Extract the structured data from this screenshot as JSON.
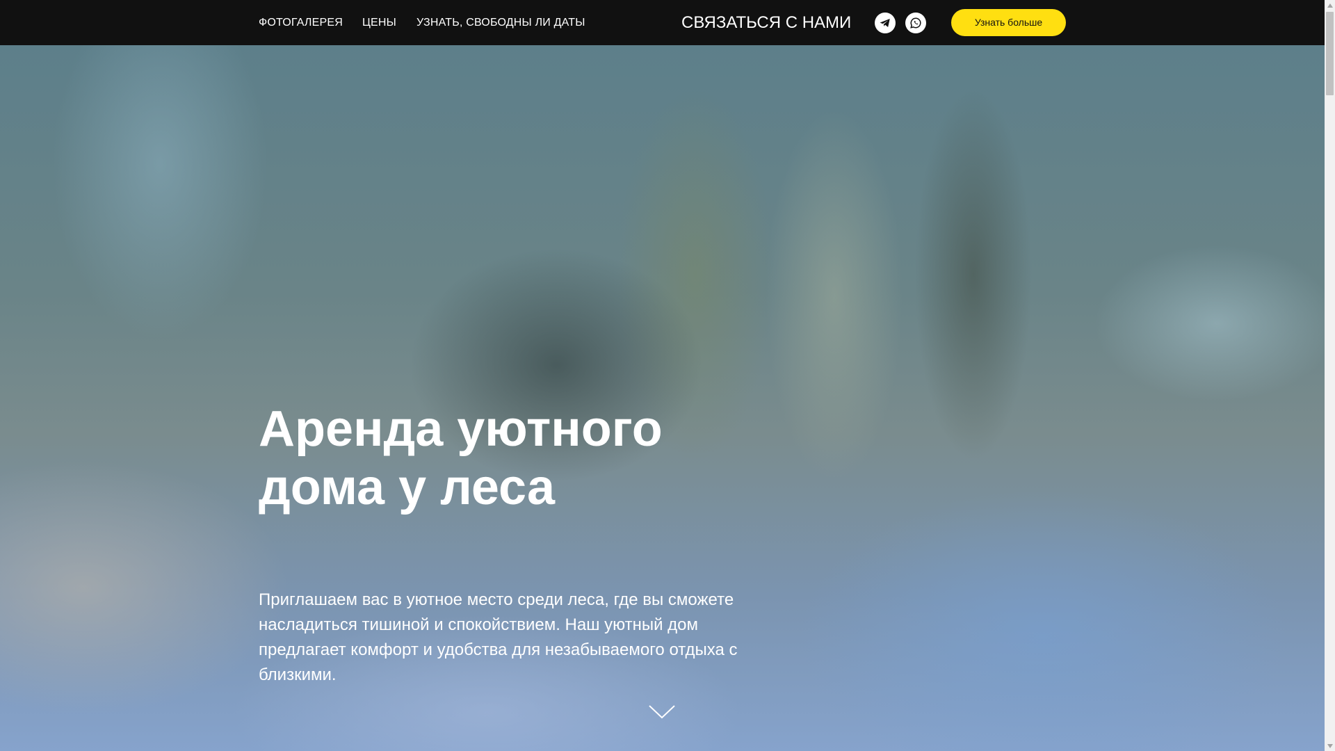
{
  "nav": {
    "gallery": "ФОТОГАЛЕРЕЯ",
    "prices": "ЦЕНЫ",
    "dates": "УЗНАТЬ, СВОБОДНЫ ЛИ ДАТЫ"
  },
  "contact": {
    "label": "СВЯЗАТЬСЯ С НАМИ"
  },
  "social": {
    "telegram_icon": "telegram-icon",
    "whatsapp_icon": "whatsapp-icon"
  },
  "cta": {
    "label": "Узнать больше"
  },
  "hero": {
    "title": "Аренда уютного дома у леса",
    "description": "Приглашаем вас в уютное место среди леса, где вы сможете насладиться тишиной и спокойствием. Наш уютный дом предлагает комфорт и удобства для незабываемого отдыха с близкими.",
    "scroll_icon": "chevron-down-icon"
  },
  "colors": {
    "header_bg": "#111111",
    "accent": "#ffdf11",
    "text": "#ffffff"
  }
}
